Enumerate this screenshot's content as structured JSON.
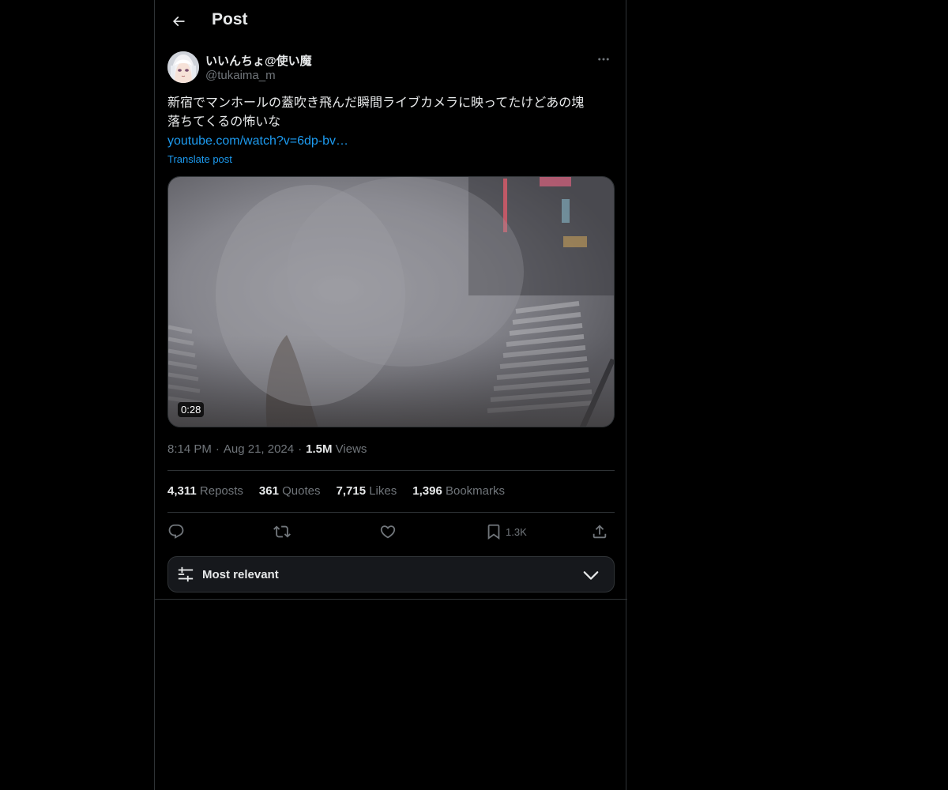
{
  "header": {
    "title": "Post"
  },
  "author": {
    "display_name": "いいんちょ@使い魔",
    "handle": "@tukaima_m"
  },
  "post": {
    "text_line1": "新宿でマンホールの蓋吹き飛んだ瞬間ライブカメラに映ってたけどあの塊",
    "text_line2": "落ちてくるの怖いな",
    "link_text": "youtube.com/watch?v=6dp-bv…",
    "translate_label": "Translate post",
    "video_duration": "0:28"
  },
  "meta": {
    "time": "8:14 PM",
    "date": "Aug 21, 2024",
    "views_count": "1.5M",
    "views_label": "Views"
  },
  "stats": [
    {
      "count": "4,311",
      "label": "Reposts"
    },
    {
      "count": "361",
      "label": "Quotes"
    },
    {
      "count": "7,715",
      "label": "Likes"
    },
    {
      "count": "1,396",
      "label": "Bookmarks"
    }
  ],
  "actions": {
    "bookmark_count": "1.3K"
  },
  "sort": {
    "label": "Most relevant"
  },
  "icons": {
    "back": "arrow-left-icon",
    "more": "more-horizontal-icon",
    "reply": "reply-icon",
    "repost": "repost-icon",
    "like": "heart-icon",
    "bookmark": "bookmark-icon",
    "share": "share-icon",
    "sort": "sliders-icon",
    "chevron": "chevron-down-icon"
  },
  "colors": {
    "background": "#000000",
    "text": "#e7e9ea",
    "secondary": "#71767b",
    "accent": "#1d9bf0",
    "border": "#2f3336"
  }
}
